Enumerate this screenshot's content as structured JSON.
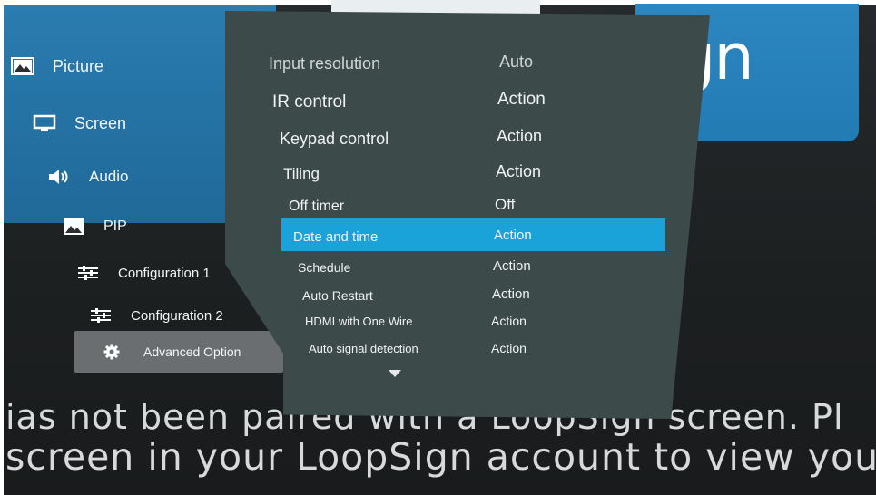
{
  "background": {
    "logo_fragment": "gn",
    "message_line_1": "ias not been paired with a LoopSign screen. Pl",
    "message_line_2": "screen in your LoopSign account to view your co"
  },
  "left_menu": {
    "items": [
      {
        "label": "Picture",
        "icon": "picture-icon"
      },
      {
        "label": "Screen",
        "icon": "monitor-icon"
      },
      {
        "label": "Audio",
        "icon": "speaker-icon"
      },
      {
        "label": "PIP",
        "icon": "pip-icon"
      },
      {
        "label": "Configuration 1",
        "icon": "sliders-icon"
      },
      {
        "label": "Configuration 2",
        "icon": "sliders-icon"
      },
      {
        "label": "Advanced Option",
        "icon": "gear-icon",
        "selected": true
      }
    ]
  },
  "osd": {
    "rows": [
      {
        "label": "Input resolution",
        "value": "Auto"
      },
      {
        "label": "IR control",
        "value": "Action"
      },
      {
        "label": "Keypad control",
        "value": "Action"
      },
      {
        "label": "Tiling",
        "value": "Action"
      },
      {
        "label": "Off timer",
        "value": "Off"
      },
      {
        "label": "Date and time",
        "value": "Action",
        "selected": true
      },
      {
        "label": "Schedule",
        "value": "Action"
      },
      {
        "label": "Auto Restart",
        "value": "Action"
      },
      {
        "label": "HDMI with One Wire",
        "value": "Action"
      },
      {
        "label": "Auto signal detection",
        "value": "Action"
      }
    ],
    "more_indicator": "chevron-down-icon"
  },
  "colors": {
    "panel": "#3d4a4a",
    "highlight": "#1aa3d9",
    "selected_left": "#6b6e70",
    "backdrop_blue": "#2c86c0"
  }
}
